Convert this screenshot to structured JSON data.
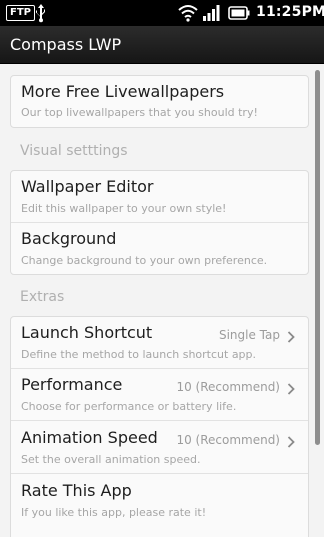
{
  "status_bar": {
    "ftp_badge": "FTP",
    "time": "11:25PM",
    "icons": [
      "ftp-icon",
      "usb-icon",
      "wifi-icon",
      "signal-icon",
      "battery-icon"
    ]
  },
  "app": {
    "title": "Compass LWP"
  },
  "promo": {
    "title": "More Free Livewallpapers",
    "subtitle": "Our top livewallpapers that you should try!"
  },
  "visual_settings": {
    "header": "Visual setttings",
    "items": [
      {
        "title": "Wallpaper Editor",
        "subtitle": "Edit this wallpaper to your own style!"
      },
      {
        "title": "Background",
        "subtitle": "Change background to your own preference."
      }
    ]
  },
  "extras": {
    "header": "Extras",
    "items": [
      {
        "title": "Launch Shortcut",
        "subtitle": "Define the method to launch shortcut app.",
        "value": "Single Tap"
      },
      {
        "title": "Performance",
        "subtitle": "Choose for performance or battery life.",
        "value": "10 (Recommend)"
      },
      {
        "title": "Animation Speed",
        "subtitle": "Set the overall animation speed.",
        "value": "10 (Recommend)"
      },
      {
        "title": "Rate This App",
        "subtitle": "If you like this app, please rate it!"
      }
    ]
  },
  "colors": {
    "status_bar": "#000000",
    "title_bar": "#1f1f1f",
    "background": "#f3f3f3",
    "card": "#fafafa",
    "section_header": "#b0b0b0"
  }
}
